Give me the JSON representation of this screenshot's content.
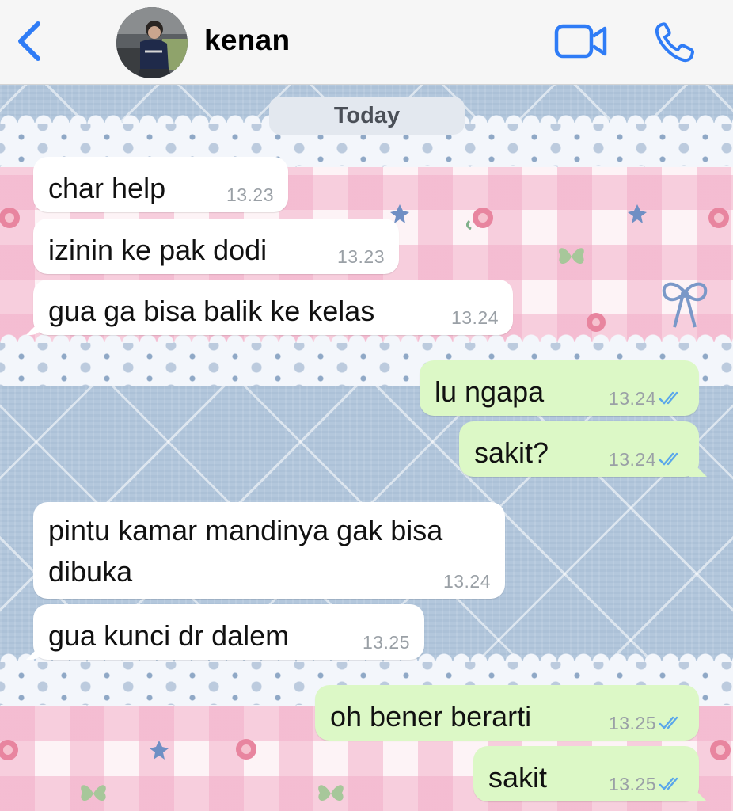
{
  "header": {
    "contact_name": "kenan",
    "back_icon": "chevron-left-icon",
    "video_icon": "video-camera-icon",
    "call_icon": "phone-icon",
    "accent_color": "#2f7cf6"
  },
  "chat": {
    "date_label": "Today",
    "messages": [
      {
        "direction": "incoming",
        "text": "char help",
        "time": "13.23"
      },
      {
        "direction": "incoming",
        "text": "izinin ke pak dodi",
        "time": "13.23"
      },
      {
        "direction": "incoming",
        "text": "gua ga bisa balik ke kelas",
        "time": "13.24"
      },
      {
        "direction": "outgoing",
        "text": "lu ngapa",
        "time": "13.24",
        "status": "read"
      },
      {
        "direction": "outgoing",
        "text": "sakit?",
        "time": "13.24",
        "status": "read"
      },
      {
        "direction": "incoming",
        "text_line1": "pintu kamar mandinya gak bisa",
        "text_line2": "dibuka",
        "time": "13.24"
      },
      {
        "direction": "incoming",
        "text": "gua kunci dr dalem",
        "time": "13.25"
      },
      {
        "direction": "outgoing",
        "text": "oh bener berarti",
        "time": "13.25",
        "status": "read"
      },
      {
        "direction": "outgoing",
        "text": "sakit",
        "time": "13.25",
        "status": "read"
      }
    ]
  },
  "colors": {
    "incoming_bubble": "#ffffff",
    "outgoing_bubble": "#dcf8c6",
    "read_ticks": "#5aa7ea"
  }
}
